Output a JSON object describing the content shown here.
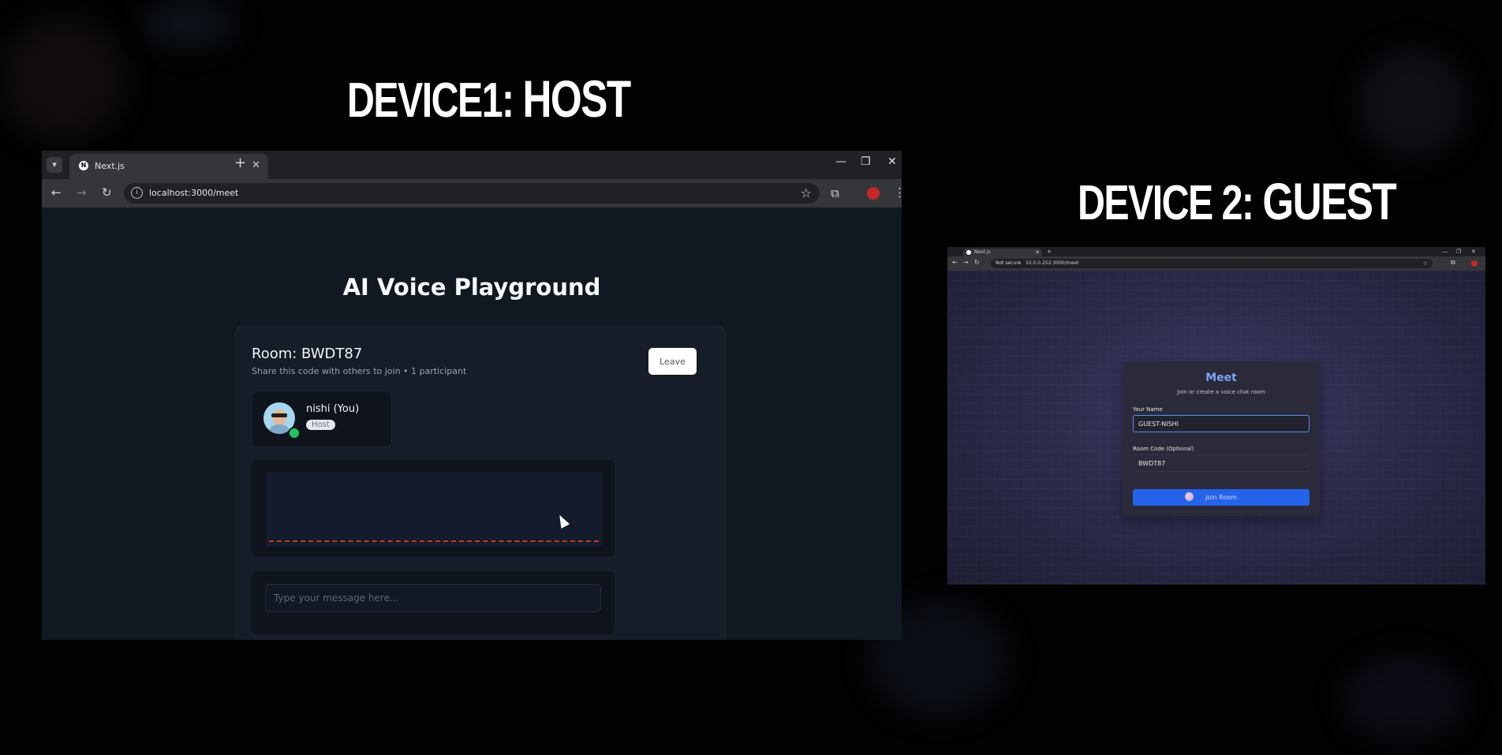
{
  "headlines": {
    "device1": {
      "prefix": "DEVICE1:",
      "role": "HOST"
    },
    "device2": {
      "prefix": "DEVICE 2:",
      "role": "GUEST"
    }
  },
  "device1": {
    "tab_title": "Next.js",
    "url": "localhost:3000/meet",
    "app_title": "AI Voice Playground",
    "room": {
      "title": "Room: BWDT87",
      "subtitle": "Share this code with others to join • 1 participant",
      "leave_label": "Leave"
    },
    "participant": {
      "name": "nishi (You)",
      "badge": "Host"
    },
    "message_placeholder": "Type your message here..."
  },
  "device2": {
    "tab_title": "Next.js",
    "security_label": "Not secure",
    "url": "10.0.0.252:3000/meet",
    "card": {
      "title": "Meet",
      "subtitle": "Join or create a voice chat room",
      "name_label": "Your Name",
      "name_value": "GUEST-NISHI",
      "room_label": "Room Code (Optional)",
      "room_value": "BWDT87",
      "join_label": "Join Room"
    }
  },
  "colors": {
    "accent_blue": "#2563eb",
    "meet_title": "#7aa4f5",
    "online": "#22c55e",
    "wave_line": "#c0392b",
    "record_dot": "#c62828"
  }
}
